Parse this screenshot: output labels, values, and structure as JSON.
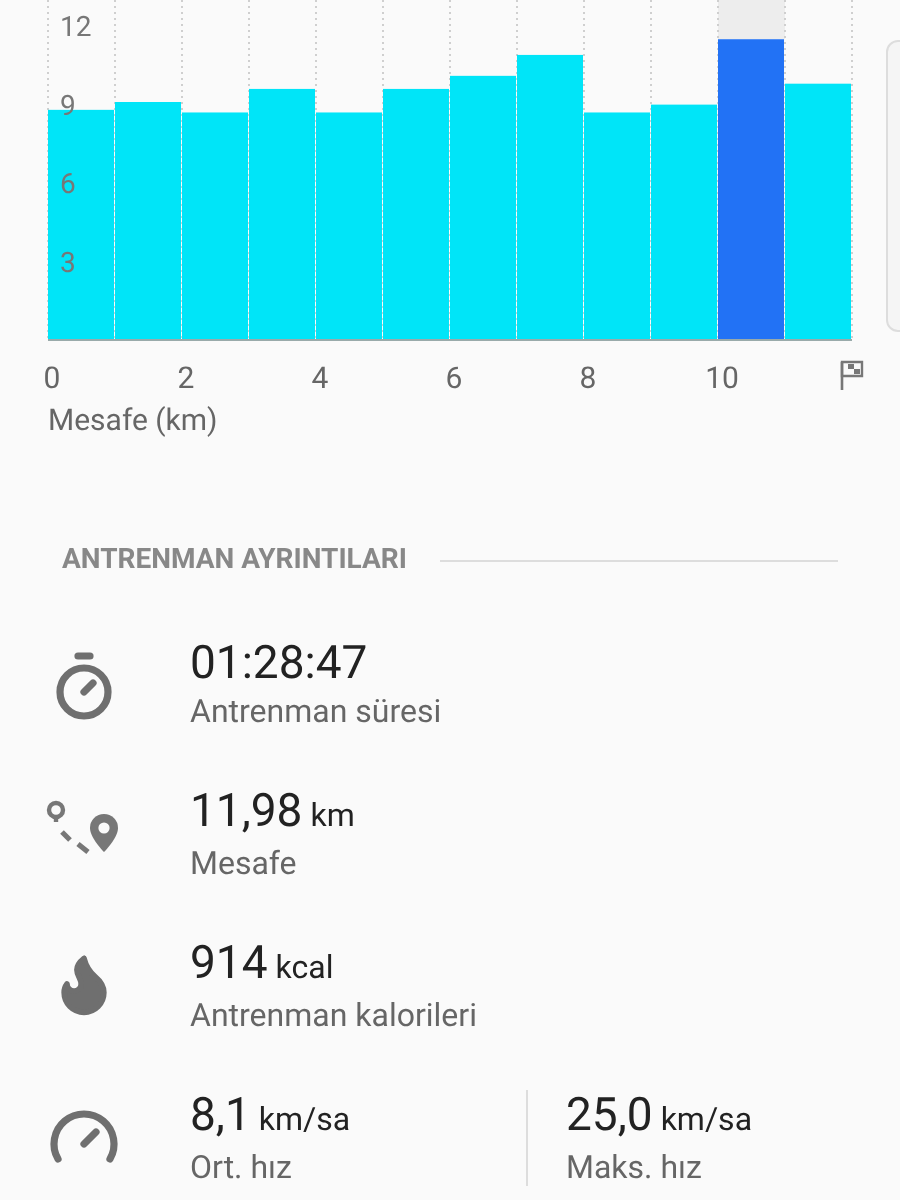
{
  "chart_data": {
    "type": "bar",
    "xlabel": "Mesafe (km)",
    "x": [
      0.5,
      1.5,
      2.5,
      3.5,
      4.5,
      5.5,
      6.5,
      7.5,
      8.5,
      9.5,
      10.5,
      11.5
    ],
    "grid": true,
    "series": [
      {
        "color": "#00e5f8",
        "values": [
          8.8,
          9.1,
          8.7,
          9.6,
          8.7,
          9.6,
          10.1,
          10.9,
          8.7,
          9.0,
          null,
          9.8
        ]
      },
      {
        "color": "#2272f5",
        "values": [
          null,
          null,
          null,
          null,
          null,
          null,
          null,
          null,
          null,
          null,
          11.5,
          null
        ]
      }
    ],
    "xlim": [
      0,
      12
    ],
    "ylim": [
      0,
      13
    ],
    "xticks": [
      0,
      2,
      4,
      6,
      8,
      10
    ],
    "yticks": [
      3,
      6,
      9,
      12
    ]
  },
  "details": {
    "title": "ANTRENMAN AYRINTILARI",
    "rows": [
      {
        "kind": "timer",
        "items": [
          {
            "value": "01:28:47",
            "label": "Antrenman süresi"
          }
        ]
      },
      {
        "kind": "route",
        "items": [
          {
            "value": "11,98",
            "unit": "km",
            "label": "Mesafe"
          }
        ]
      },
      {
        "kind": "flame",
        "items": [
          {
            "value": "914",
            "unit": "kcal",
            "label": "Antrenman kalorileri"
          }
        ]
      },
      {
        "kind": "gauge",
        "items": [
          {
            "value": "8,1",
            "unit": "km/sa",
            "label": "Ort. hız"
          },
          {
            "value": "25,0",
            "unit": "km/sa",
            "label": "Maks. hız"
          }
        ]
      }
    ]
  }
}
